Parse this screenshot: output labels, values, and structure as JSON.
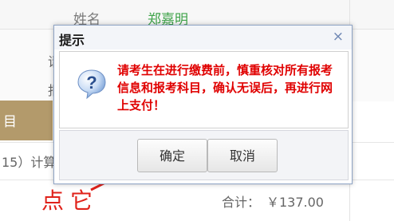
{
  "background": {
    "header_left": "姓名",
    "header_link": "郑嘉明",
    "label_1": "请",
    "label_2": "报",
    "gold_tab_label": "目",
    "row_text": "15）计算",
    "total_label": "合计：",
    "total_value": "￥137.00"
  },
  "dialog": {
    "title": "提示",
    "close_icon": "×",
    "message": "请考生在进行缴费前，慎重核对所有报考信息和报考科目，确认无误后，再进行网上支付！",
    "ok_label": "确定",
    "cancel_label": "取消"
  },
  "annotation": {
    "text": "点它",
    "color": "#e0221a"
  }
}
